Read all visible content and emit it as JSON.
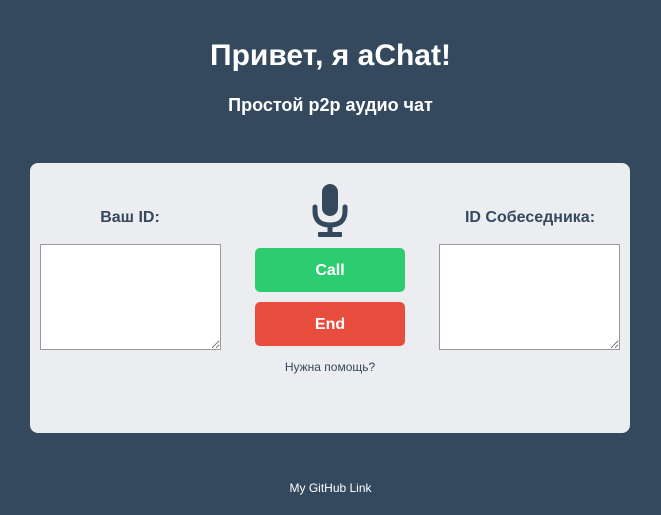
{
  "header": {
    "title": "Привет, я aChat!",
    "subtitle": "Простой p2p аудио чат"
  },
  "panel": {
    "your_id_label": "Ваш ID:",
    "your_id_value": "",
    "peer_id_label": "ID Собеседника:",
    "peer_id_value": "",
    "mic_icon": "microphone-icon",
    "call_label": "Call",
    "end_label": "End",
    "help_link": "Нужна помощь?"
  },
  "footer": {
    "link": "My GitHub Link"
  },
  "colors": {
    "background": "#34495e",
    "card": "#ecedf0",
    "call": "#2ecc71",
    "end": "#e74c3c",
    "text_dark": "#34495e"
  }
}
